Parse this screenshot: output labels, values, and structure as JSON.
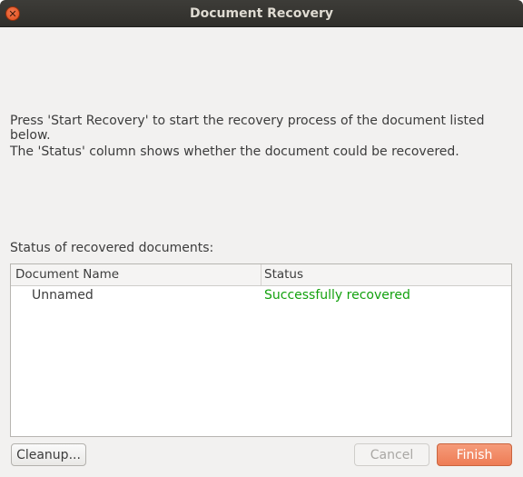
{
  "window": {
    "title": "Document Recovery",
    "close_icon": "close-icon"
  },
  "intro": {
    "line1": "Press 'Start Recovery' to start the recovery process of the document listed below.",
    "line2": "The 'Status' column shows whether the document could be recovered."
  },
  "status_section": {
    "label": "Status of recovered documents:"
  },
  "table": {
    "columns": [
      "Document Name",
      "Status"
    ],
    "rows": [
      {
        "name": "Unnamed",
        "status": "Successfully recovered"
      }
    ]
  },
  "buttons": {
    "cleanup": "Cleanup...",
    "cancel": "Cancel",
    "finish": "Finish"
  },
  "colors": {
    "success": "#13a10e",
    "accent": "#ee7c55",
    "titlebar": "#302f2b"
  }
}
